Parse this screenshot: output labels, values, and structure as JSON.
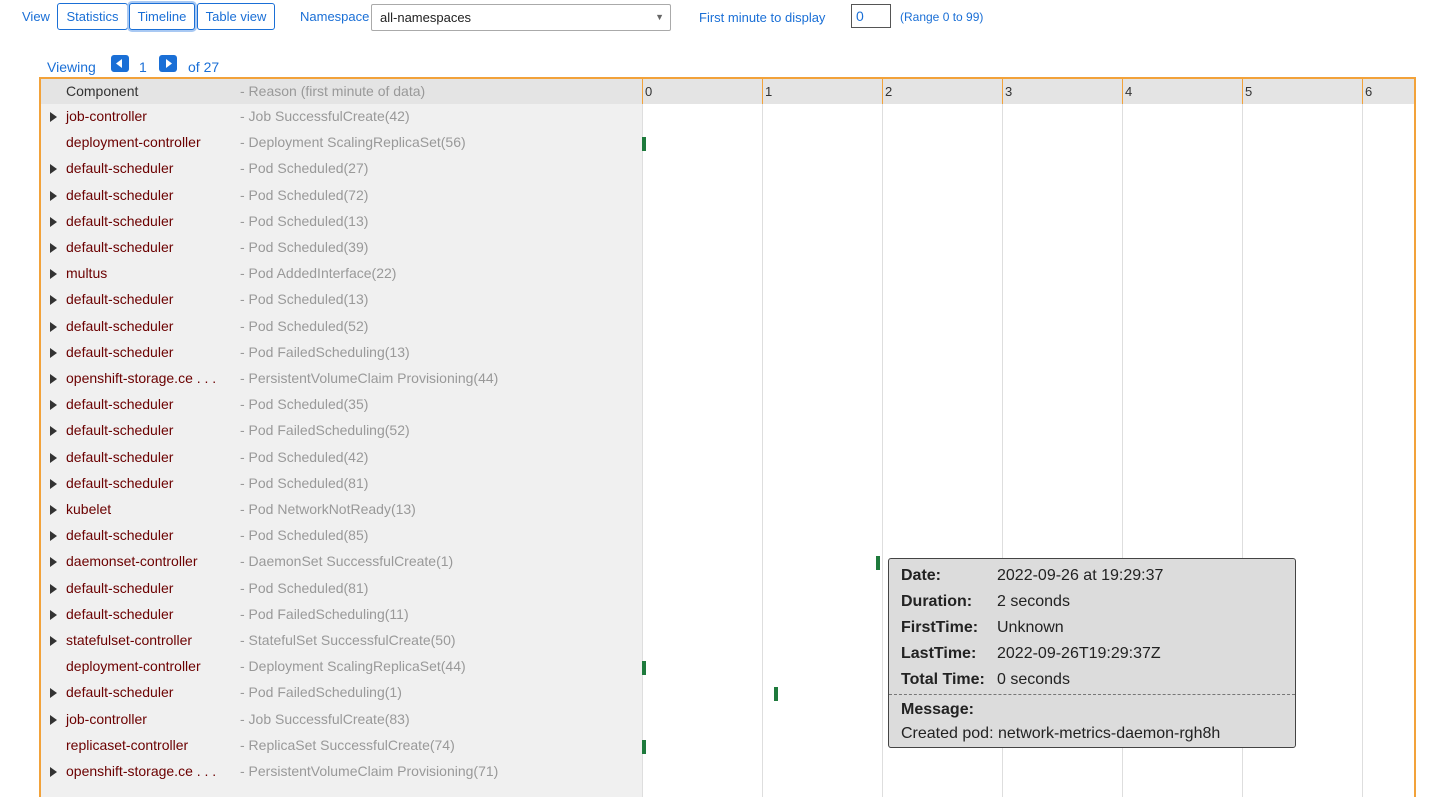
{
  "toolbar": {
    "view_label": "View",
    "buttons": [
      "Statistics",
      "Timeline",
      "Table view"
    ],
    "active_button": "Timeline",
    "namespace_label": "Namespace",
    "namespace_value": "all-namespaces",
    "first_minute_label": "First minute to display",
    "first_minute_value": "0",
    "range_text": "(Range 0 to 99)"
  },
  "pager": {
    "viewing": "Viewing",
    "page": "1",
    "of_text": "of 27"
  },
  "timeline": {
    "header_component": "Component",
    "header_reason": "- Reason (first minute of data)",
    "minutes": [
      "0",
      "1",
      "2",
      "3",
      "4",
      "5",
      "6"
    ],
    "colors": {
      "border": "#f2a23a",
      "bar": "#1e7a3c",
      "component": "#6b0000",
      "link": "#1a6fd6"
    },
    "rows": [
      {
        "expandable": true,
        "component": "job-controller",
        "reason": "- Job SuccessfulCreate(42)"
      },
      {
        "expandable": false,
        "component": "deployment-controller",
        "reason": "- Deployment ScalingReplicaSet(56)"
      },
      {
        "expandable": true,
        "component": "default-scheduler",
        "reason": "- Pod Scheduled(27)"
      },
      {
        "expandable": true,
        "component": "default-scheduler",
        "reason": "- Pod Scheduled(72)"
      },
      {
        "expandable": true,
        "component": "default-scheduler",
        "reason": "- Pod Scheduled(13)"
      },
      {
        "expandable": true,
        "component": "default-scheduler",
        "reason": "- Pod Scheduled(39)"
      },
      {
        "expandable": true,
        "component": "multus",
        "reason": "- Pod AddedInterface(22)"
      },
      {
        "expandable": true,
        "component": "default-scheduler",
        "reason": "- Pod Scheduled(13)"
      },
      {
        "expandable": true,
        "component": "default-scheduler",
        "reason": "- Pod Scheduled(52)"
      },
      {
        "expandable": true,
        "component": "default-scheduler",
        "reason": "- Pod FailedScheduling(13)"
      },
      {
        "expandable": true,
        "component": "openshift-storage.ce . . .",
        "reason": "- PersistentVolumeClaim Provisioning(44)"
      },
      {
        "expandable": true,
        "component": "default-scheduler",
        "reason": "- Pod Scheduled(35)"
      },
      {
        "expandable": true,
        "component": "default-scheduler",
        "reason": "- Pod FailedScheduling(52)"
      },
      {
        "expandable": true,
        "component": "default-scheduler",
        "reason": "- Pod Scheduled(42)"
      },
      {
        "expandable": true,
        "component": "default-scheduler",
        "reason": "- Pod Scheduled(81)"
      },
      {
        "expandable": true,
        "component": "kubelet",
        "reason": "- Pod NetworkNotReady(13)"
      },
      {
        "expandable": true,
        "component": "default-scheduler",
        "reason": "- Pod Scheduled(85)"
      },
      {
        "expandable": true,
        "component": "daemonset-controller",
        "reason": "- DaemonSet SuccessfulCreate(1)"
      },
      {
        "expandable": true,
        "component": "default-scheduler",
        "reason": "- Pod Scheduled(81)"
      },
      {
        "expandable": true,
        "component": "default-scheduler",
        "reason": "- Pod FailedScheduling(11)"
      },
      {
        "expandable": true,
        "component": "statefulset-controller",
        "reason": "- StatefulSet SuccessfulCreate(50)"
      },
      {
        "expandable": false,
        "component": "deployment-controller",
        "reason": "- Deployment ScalingReplicaSet(44)"
      },
      {
        "expandable": true,
        "component": "default-scheduler",
        "reason": "- Pod FailedScheduling(1)"
      },
      {
        "expandable": true,
        "component": "job-controller",
        "reason": "- Job SuccessfulCreate(83)"
      },
      {
        "expandable": false,
        "component": "replicaset-controller",
        "reason": "- ReplicaSet SuccessfulCreate(74)"
      },
      {
        "expandable": true,
        "component": "openshift-storage.ce . . .",
        "reason": "- PersistentVolumeClaim Provisioning(71)"
      }
    ],
    "events": [
      {
        "row": 1,
        "minute": 0.0
      },
      {
        "row": 17,
        "minute": 1.95
      },
      {
        "row": 21,
        "minute": 0.0
      },
      {
        "row": 22,
        "minute": 1.1
      },
      {
        "row": 24,
        "minute": 0.0
      }
    ]
  },
  "tooltip": {
    "fields": [
      {
        "key": "Date:",
        "value": "2022-09-26 at 19:29:37"
      },
      {
        "key": "Duration:",
        "value": "2 seconds"
      },
      {
        "key": "FirstTime:",
        "value": "Unknown"
      },
      {
        "key": "LastTime:",
        "value": "2022-09-26T19:29:37Z"
      },
      {
        "key": "Total Time:",
        "value": "0 seconds"
      }
    ],
    "message_label": "Message:",
    "message_value": "Created pod: network-metrics-daemon-rgh8h"
  }
}
